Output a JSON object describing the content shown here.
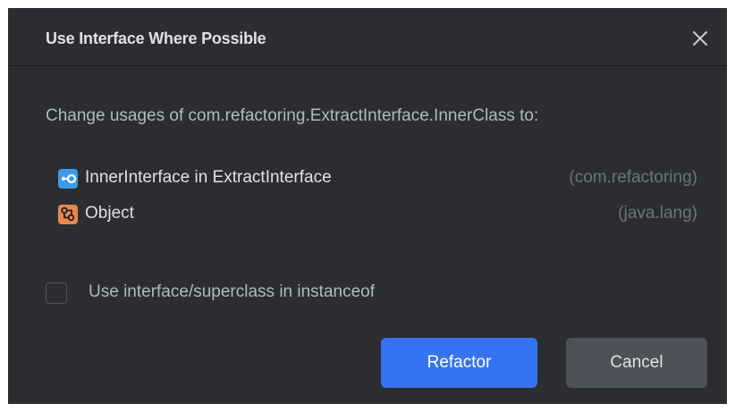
{
  "dialog": {
    "title": "Use Interface Where Possible",
    "message": "Change usages of com.refactoring.ExtractInterface.InnerClass to:",
    "items": [
      {
        "name": "InnerInterface in ExtractInterface",
        "package": "(com.refactoring)",
        "icon": "interface-icon"
      },
      {
        "name": "Object",
        "package": "(java.lang)",
        "icon": "class-icon"
      }
    ],
    "checkbox": {
      "label": "Use interface/superclass in instanceof",
      "checked": false
    },
    "buttons": {
      "refactor": "Refactor",
      "cancel": "Cancel"
    }
  },
  "colors": {
    "background": "#2b2d30",
    "primary": "#3574f0",
    "secondary": "#4e5157",
    "interface_icon": "#3d9ae8",
    "class_icon": "#e8874d"
  }
}
